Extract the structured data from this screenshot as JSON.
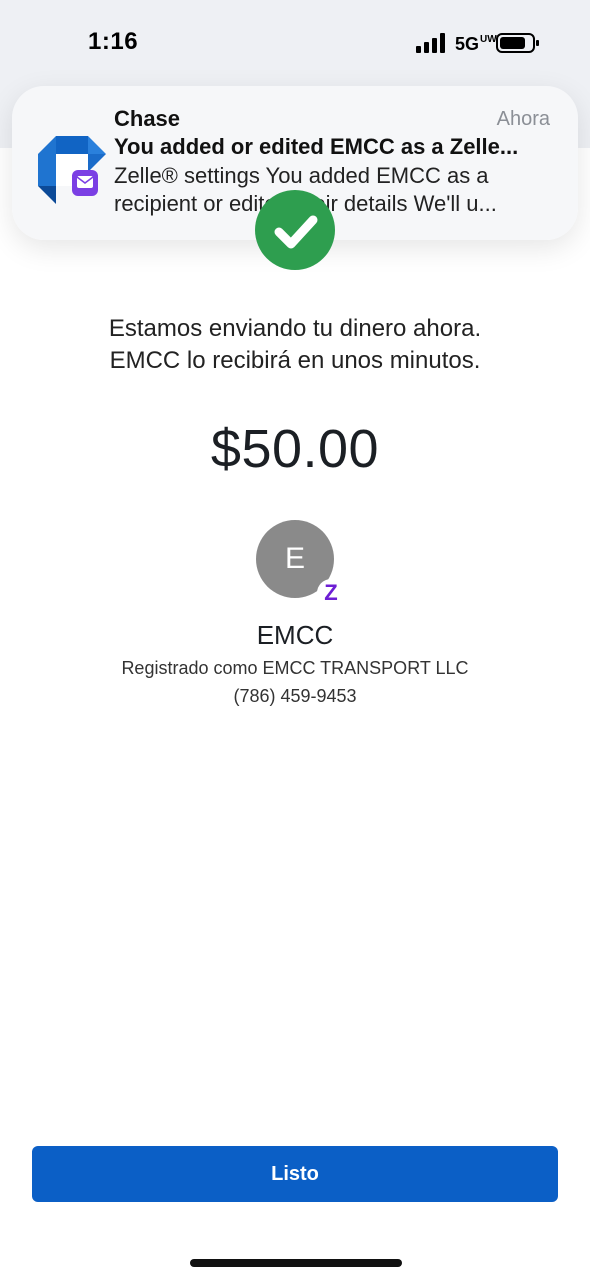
{
  "status_bar": {
    "time": "1:16",
    "network": "5G",
    "network_suffix": "UW",
    "icons": [
      "signal-icon",
      "battery-icon"
    ]
  },
  "notification": {
    "app": "Chase",
    "time": "Ahora",
    "title": "You added or edited EMCC as a Zelle...",
    "body": "Zelle® settings You added EMCC as a recipient or edited their details We'll u...",
    "icon": "chase-app-icon",
    "badge_icon": "mail-badge-icon"
  },
  "confirmation": {
    "message_line1": "Estamos enviando tu dinero ahora.",
    "message_line2": "EMCC lo recibirá en unos minutos.",
    "amount": "$50.00",
    "status_icon": "checkmark-icon",
    "status_color": "#2e9e4f"
  },
  "recipient": {
    "initial": "E",
    "zelle_badge": "Z",
    "name": "EMCC",
    "registered_as": "Registrado como EMCC TRANSPORT LLC",
    "phone": "(786) 459-9453"
  },
  "actions": {
    "done_label": "Listo",
    "done_color": "#0b5fc6"
  }
}
